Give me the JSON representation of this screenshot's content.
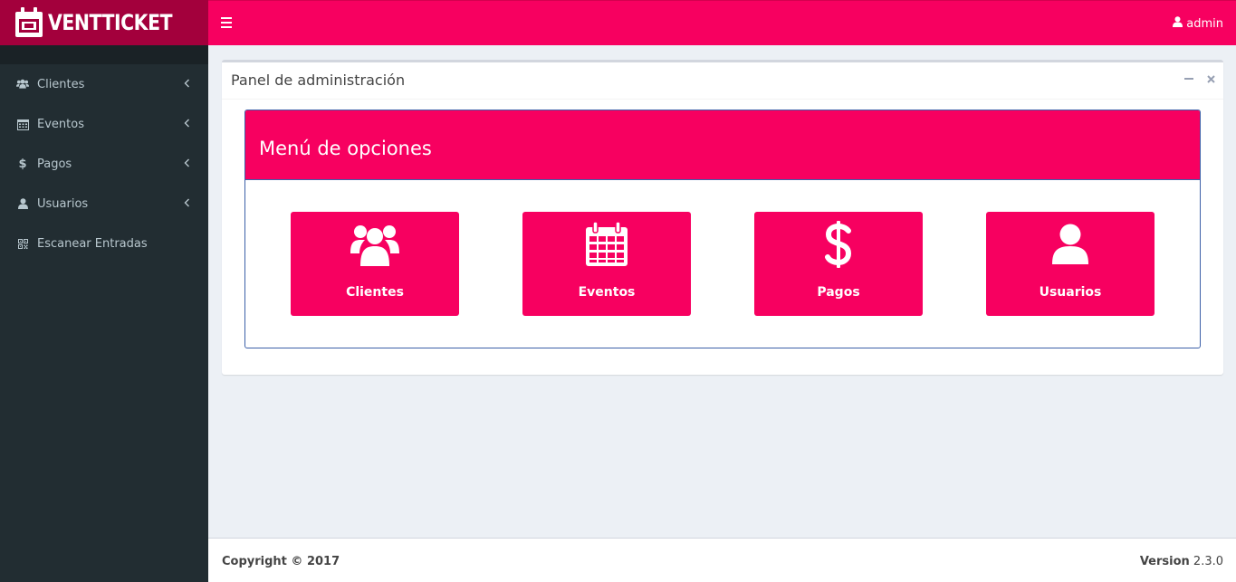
{
  "header": {
    "logo_text": "VENTTICKET",
    "user_label": "admin"
  },
  "sidebar": {
    "items": [
      {
        "label": "Clientes",
        "icon": "users-icon",
        "has_submenu": true
      },
      {
        "label": "Eventos",
        "icon": "calendar-icon",
        "has_submenu": true
      },
      {
        "label": "Pagos",
        "icon": "dollar-icon",
        "has_submenu": true
      },
      {
        "label": "Usuarios",
        "icon": "user-icon",
        "has_submenu": true
      },
      {
        "label": "Escanear Entradas",
        "icon": "qrcode-icon",
        "has_submenu": false
      }
    ]
  },
  "panel": {
    "title": "Panel de administración",
    "menu_title": "Menú de opciones",
    "tiles": [
      {
        "label": "Clientes",
        "icon": "users-icon"
      },
      {
        "label": "Eventos",
        "icon": "calendar-icon"
      },
      {
        "label": "Pagos",
        "icon": "dollar-icon"
      },
      {
        "label": "Usuarios",
        "icon": "user-icon"
      }
    ]
  },
  "footer": {
    "copyright": "Copyright © 2017",
    "version_label": "Version",
    "version_number": "2.3.0"
  },
  "colors": {
    "brand": "#f70060",
    "brand_dark": "#a3003c",
    "sidebar": "#222d32",
    "inner_border": "#3c60a8"
  }
}
